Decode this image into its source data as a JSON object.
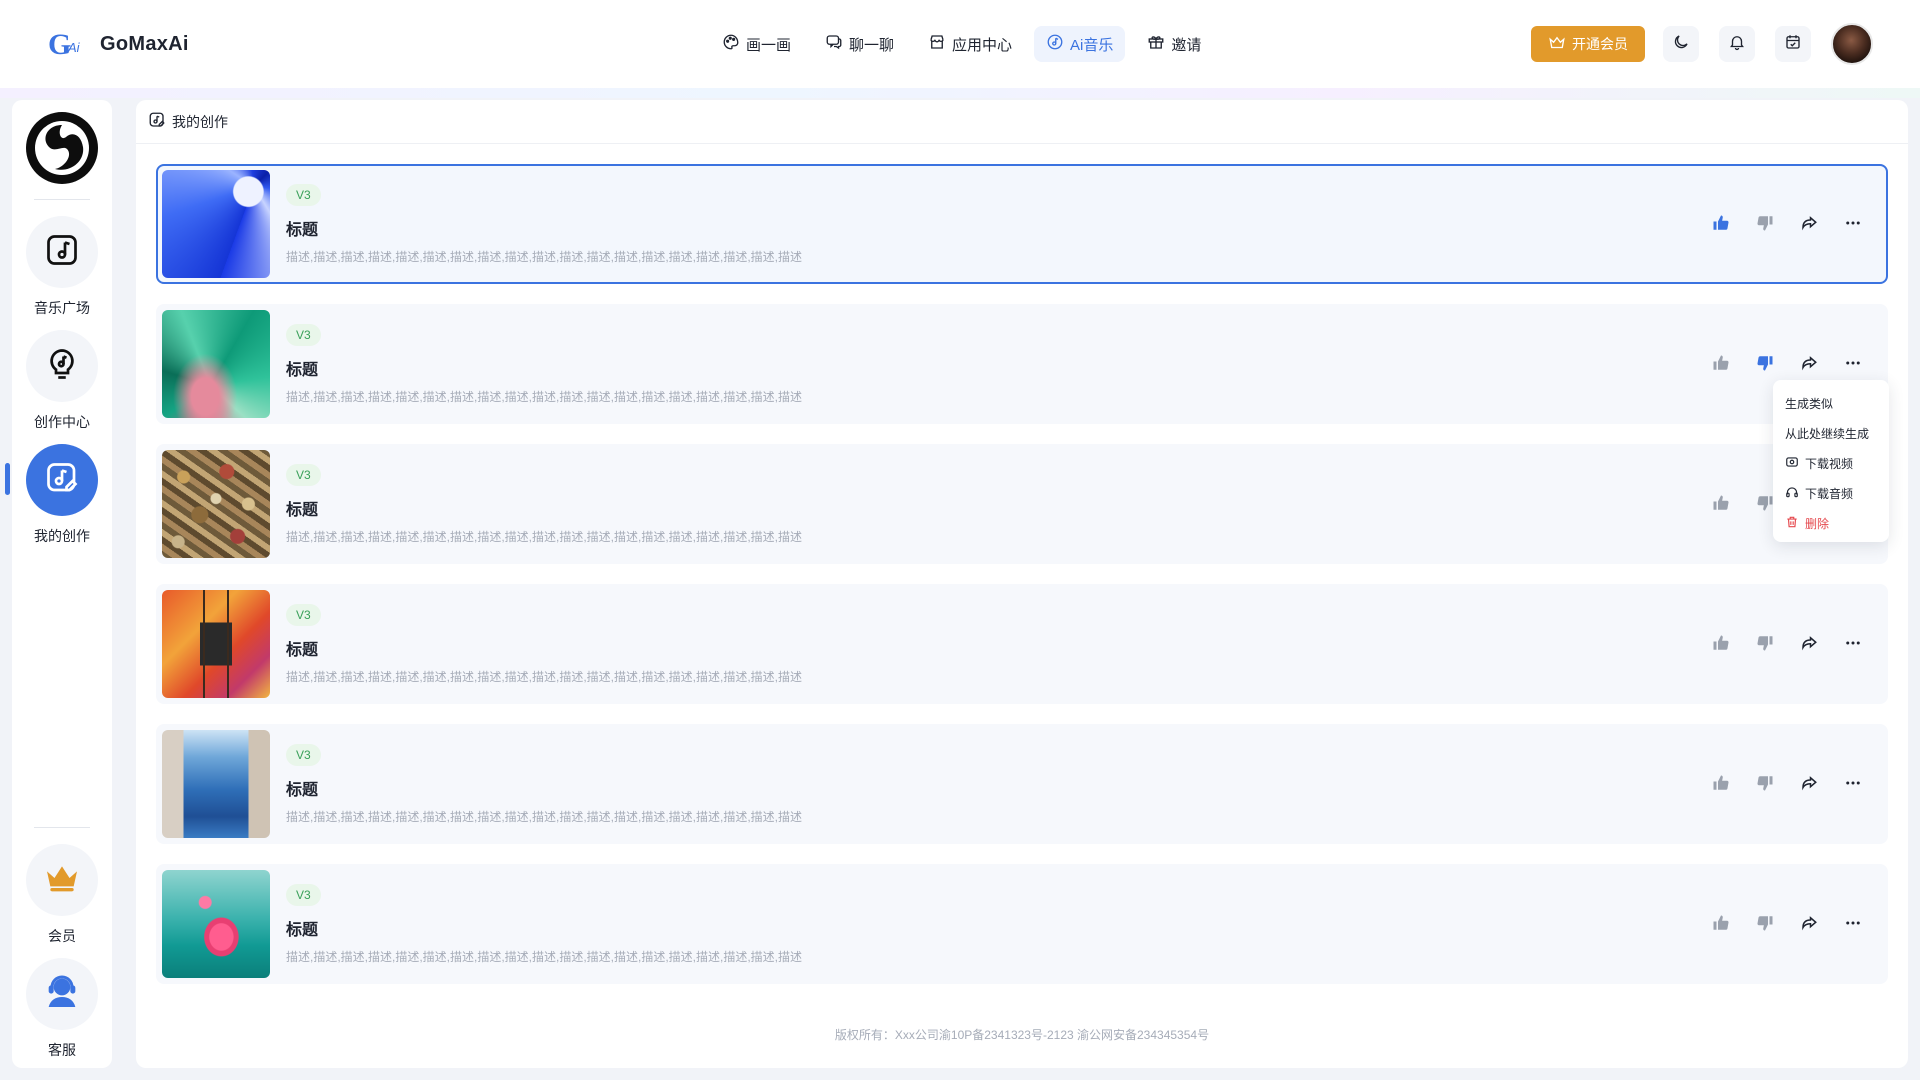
{
  "app": {
    "name": "GoMaxAi",
    "logo_text": "GAi"
  },
  "nav": {
    "items": [
      {
        "label": "画一画",
        "icon": "palette-icon"
      },
      {
        "label": "聊一聊",
        "icon": "chat-icon"
      },
      {
        "label": "应用中心",
        "icon": "store-icon"
      },
      {
        "label": "Ai音乐",
        "icon": "music-disc-icon",
        "active": true
      },
      {
        "label": "邀请",
        "icon": "gift-icon"
      }
    ],
    "vip_label": "开通会员"
  },
  "sidebar": {
    "items": [
      {
        "label": "音乐广场",
        "icon": "music-note-icon"
      },
      {
        "label": "创作中心",
        "icon": "bulb-note-icon"
      },
      {
        "label": "我的创作",
        "icon": "music-edit-icon",
        "active": true
      }
    ],
    "bottom_items": [
      {
        "label": "会员",
        "icon": "crown-icon"
      },
      {
        "label": "客服",
        "icon": "customer-service-icon"
      }
    ]
  },
  "main": {
    "header_title": "我的创作",
    "songs": [
      {
        "tag": "V3",
        "title": "标题",
        "desc": "描述,描述,描述,描述,描述,描述,描述,描述,描述,描述,描述,描述,描述,描述,描述,描述,描述,描述,描述",
        "liked": true,
        "disliked": false
      },
      {
        "tag": "V3",
        "title": "标题",
        "desc": "描述,描述,描述,描述,描述,描述,描述,描述,描述,描述,描述,描述,描述,描述,描述,描述,描述,描述,描述",
        "liked": false,
        "disliked": true
      },
      {
        "tag": "V3",
        "title": "标题",
        "desc": "描述,描述,描述,描述,描述,描述,描述,描述,描述,描述,描述,描述,描述,描述,描述,描述,描述,描述,描述",
        "liked": false,
        "disliked": false
      },
      {
        "tag": "V3",
        "title": "标题",
        "desc": "描述,描述,描述,描述,描述,描述,描述,描述,描述,描述,描述,描述,描述,描述,描述,描述,描述,描述,描述",
        "liked": false,
        "disliked": false
      },
      {
        "tag": "V3",
        "title": "标题",
        "desc": "描述,描述,描述,描述,描述,描述,描述,描述,描述,描述,描述,描述,描述,描述,描述,描述,描述,描述,描述",
        "liked": false,
        "disliked": false
      },
      {
        "tag": "V3",
        "title": "标题",
        "desc": "描述,描述,描述,描述,描述,描述,描述,描述,描述,描述,描述,描述,描述,描述,描述,描述,描述,描述,描述",
        "liked": false,
        "disliked": false
      }
    ],
    "context_menu": [
      {
        "label": "生成类似"
      },
      {
        "label": "从此处继续生成"
      },
      {
        "label": "下载视频",
        "icon": "video-icon"
      },
      {
        "label": "下载音频",
        "icon": "headphone-icon"
      },
      {
        "label": "删除",
        "icon": "trash-icon",
        "danger": true
      }
    ],
    "footer": "版权所有：Xxx公司渝10P备2341323号-2123 渝公网安备234345354号"
  },
  "colors": {
    "accent": "#3b73e0",
    "vip": "#e29a2b",
    "tag_bg": "#e9f6ea",
    "tag_text": "#3aa05a",
    "danger": "#e5484d"
  }
}
